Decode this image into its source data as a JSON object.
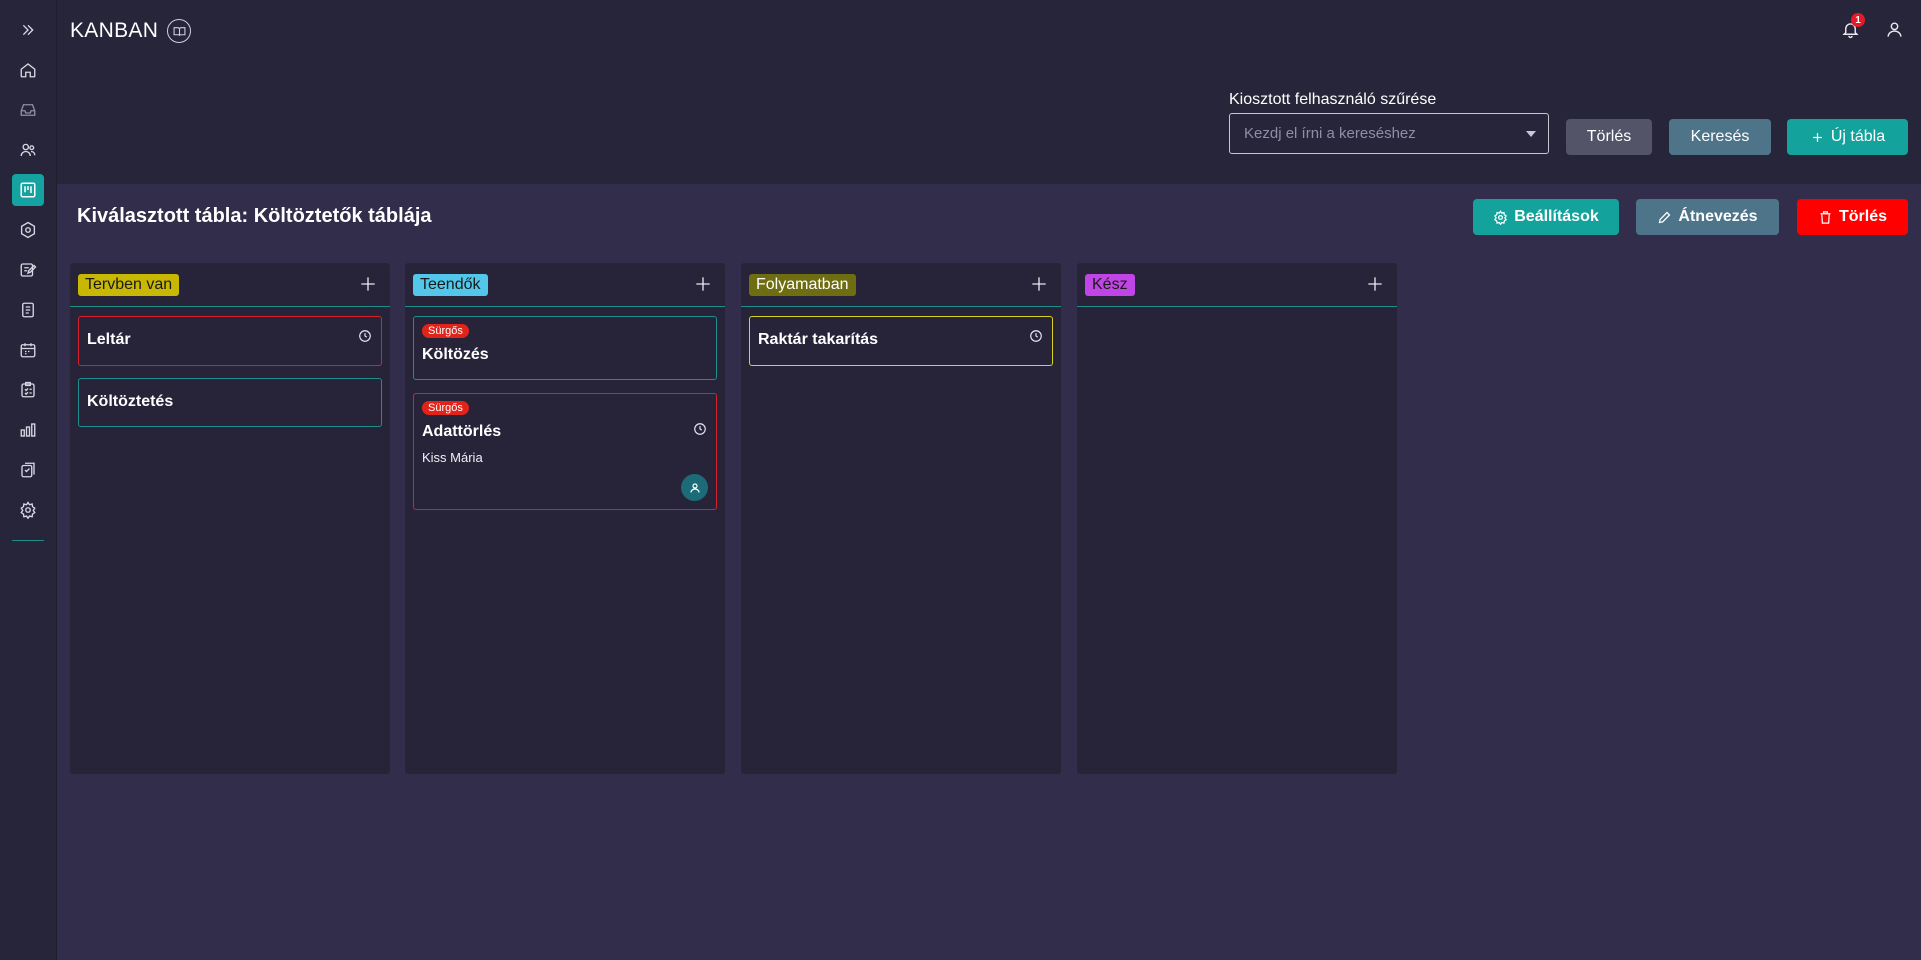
{
  "app": {
    "title": "KANBAN"
  },
  "header": {
    "notification_count": "1"
  },
  "sidebar": {
    "items": [
      {
        "name": "expand",
        "icon": "double-chevron-right-icon"
      },
      {
        "name": "home",
        "icon": "home-icon"
      },
      {
        "name": "inbox",
        "icon": "inbox-icon"
      },
      {
        "name": "users",
        "icon": "users-icon"
      },
      {
        "name": "kanban",
        "icon": "kanban-icon",
        "active": true
      },
      {
        "name": "network",
        "icon": "network-icon"
      },
      {
        "name": "edit",
        "icon": "edit-document-icon"
      },
      {
        "name": "document",
        "icon": "document-icon"
      },
      {
        "name": "calendar",
        "icon": "calendar-icon"
      },
      {
        "name": "checklist",
        "icon": "checklist-icon"
      },
      {
        "name": "chart",
        "icon": "bar-chart-icon"
      },
      {
        "name": "clipboard",
        "icon": "clipboard-icon"
      },
      {
        "name": "settings",
        "icon": "gear-icon"
      }
    ]
  },
  "filter": {
    "label": "Kiosztott felhasználó szűrése",
    "placeholder": "Kezdj el írni a kereséshez",
    "clear_label": "Törlés",
    "search_label": "Keresés",
    "new_board_label": "Új tábla"
  },
  "board": {
    "title": "Kiválasztott tábla: Költöztetők táblája",
    "settings_label": "Beállítások",
    "rename_label": "Átnevezés",
    "delete_label": "Törlés",
    "columns": [
      {
        "label": "Tervben van",
        "color": "#c8b804",
        "cards": [
          {
            "title": "Leltár",
            "border": "#d8202b",
            "has_clock": true
          },
          {
            "title": "Költöztetés",
            "border": "#1c8f8c",
            "has_clock": false
          }
        ]
      },
      {
        "label": "Teendők",
        "color": "#52c7ea",
        "cards": [
          {
            "title": "Költözés",
            "border": "#1c8f8c",
            "badge": "Sürgős",
            "has_clock": false
          },
          {
            "title": "Adattörlés",
            "border": "#d8202b",
            "badge": "Sürgős",
            "has_clock": true,
            "assignee": "Kiss Mária"
          }
        ]
      },
      {
        "label": "Folyamatban",
        "color": "#6f6d11",
        "cards": [
          {
            "title": "Raktár takarítás",
            "border": "#d9d221",
            "has_clock": true
          }
        ]
      },
      {
        "label": "Kész",
        "color": "#c145e6",
        "cards": []
      }
    ]
  }
}
